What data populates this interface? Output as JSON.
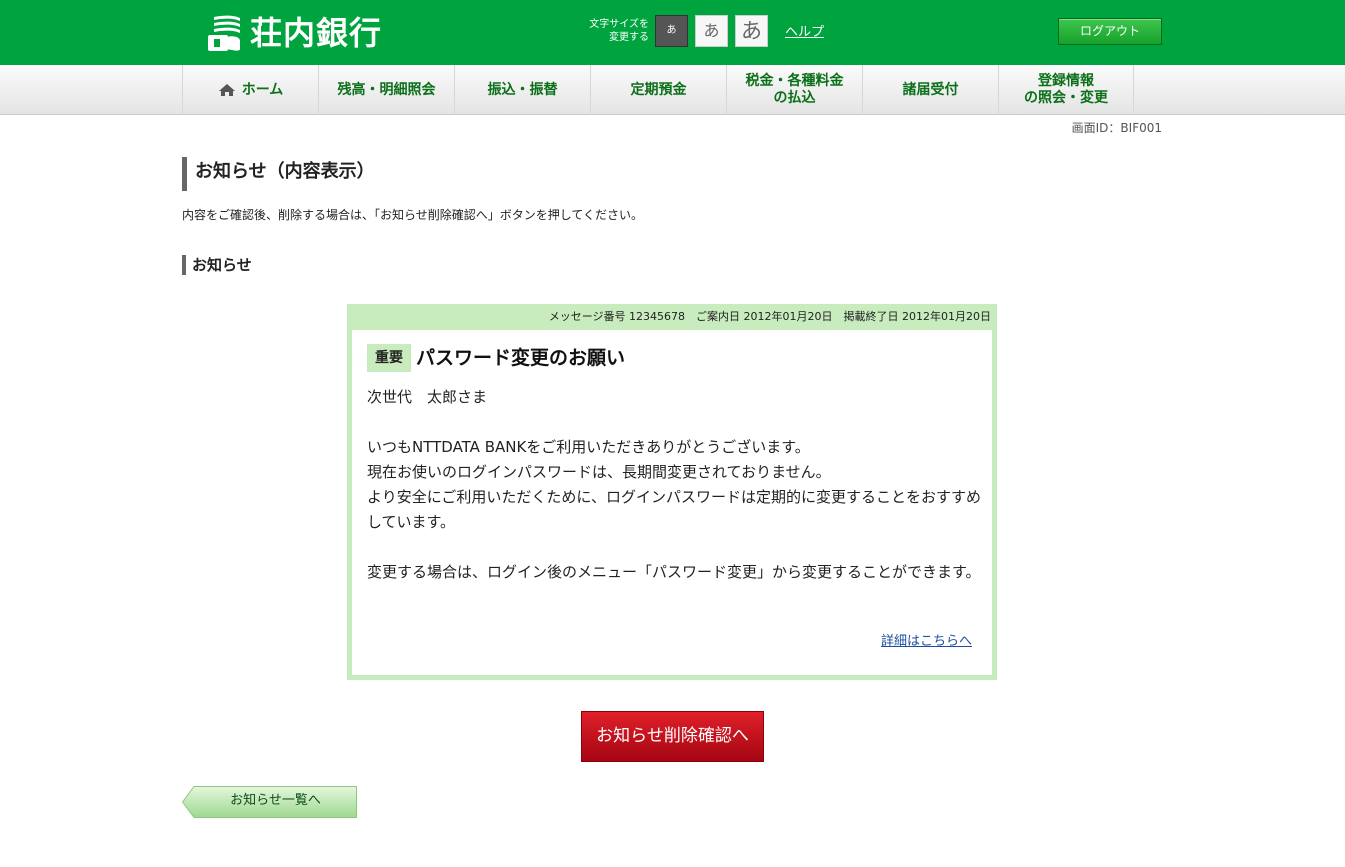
{
  "header": {
    "bank_name": "荘内銀行",
    "font_size_label_line1": "文字サイズを",
    "font_size_label_line2": "変更する",
    "font_size_small": "あ",
    "font_size_medium": "あ",
    "font_size_large": "あ",
    "help_label": "ヘルプ",
    "logout_label": "ログアウト",
    "brand_color": "#00a43f"
  },
  "nav": {
    "items": [
      {
        "label": "ホーム",
        "icon": "home-icon"
      },
      {
        "label": "残高・明細照会"
      },
      {
        "label": "振込・振替"
      },
      {
        "label": "定期預金"
      },
      {
        "label_line1": "税金・各種料金",
        "label_line2": "の払込"
      },
      {
        "label": "諸届受付"
      },
      {
        "label_line1": "登録情報",
        "label_line2": "の照会・変更"
      }
    ]
  },
  "screen_id": "画面ID：BIF001",
  "page": {
    "title": "お知らせ（内容表示）",
    "instruction": "内容をご確認後、削除する場合は、「お知らせ削除確認へ」ボタンを押してください。",
    "section_title": "お知らせ"
  },
  "notice": {
    "meta": "メッセージ番号 12345678　ご案内日 2012年01月20日　掲載終了日 2012年01月20日",
    "badge": "重要",
    "title": "パスワード変更のお願い",
    "recipient": "次世代　太郎さま",
    "line1": "いつもNTTDATA BANKをご利用いただきありがとうございます。",
    "line2": "現在お使いのログインパスワードは、長期間変更されておりません。",
    "line3": "より安全にご利用いただくために、ログインパスワードは定期的に変更することをおすすめしています。",
    "line4": "変更する場合は、ログイン後のメニュー「パスワード変更」から変更することができます。",
    "detail_link": "詳細はこちらへ",
    "accent_color": "#c9ecbf"
  },
  "actions": {
    "delete_confirm_label": "お知らせ削除確認へ",
    "back_label": "お知らせ一覧へ",
    "primary_color": "#c8101c"
  }
}
